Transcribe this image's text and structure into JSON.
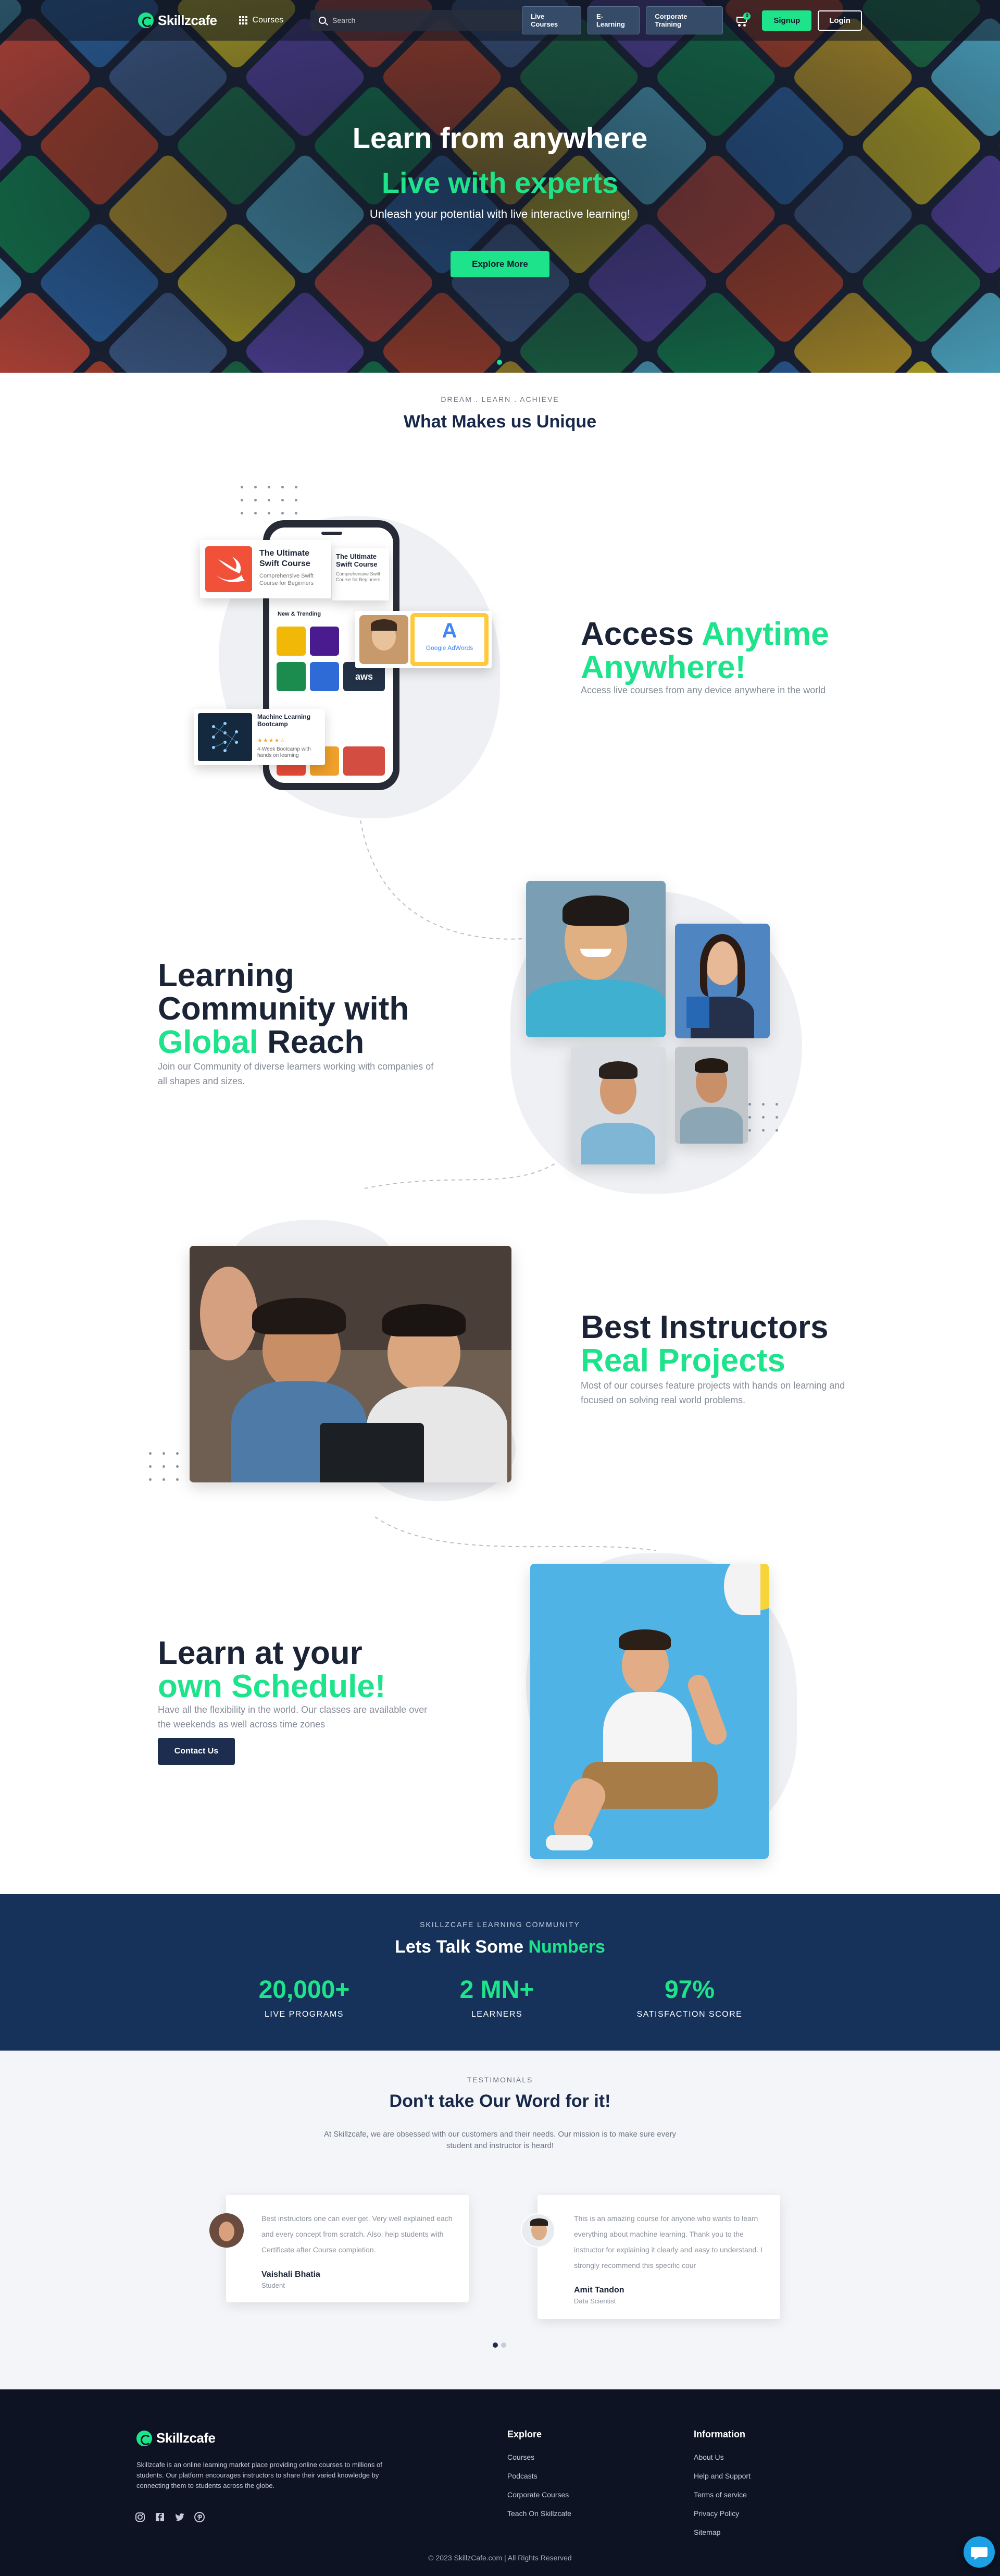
{
  "nav": {
    "logo_text": "Skillzcafe",
    "courses_label": "Courses",
    "search_placeholder": "Search",
    "pills": [
      "Live Courses",
      "E-Learning",
      "Corporate Training"
    ],
    "cart_count": "0",
    "signup_label": "Signup",
    "login_label": "Login"
  },
  "hero": {
    "title": "Learn from anywhere",
    "title_accent": "Live with experts",
    "subtitle": "Unleash your potential with live interactive learning!",
    "cta": "Explore More"
  },
  "unique": {
    "kicker": "DREAM . LEARN . ACHIEVE",
    "title": "What Makes us Unique"
  },
  "features": [
    {
      "heading": "Access ",
      "accent": "Anytime Anywhere!",
      "body": "Access live courses from any device anywhere in the world"
    },
    {
      "heading_line1": "Learning",
      "heading_line2": "Community with",
      "accent": "Global",
      "heading_tail": " Reach",
      "body": "Join our Community of diverse learners working with companies of all shapes and sizes."
    },
    {
      "heading": "Best Instructors",
      "accent": "Real Projects",
      "body": "Most of our courses feature projects with hands on learning and focused on solving real world problems."
    },
    {
      "heading": "Learn at your",
      "accent": "own Schedule!",
      "body": "Have all the flexibility in the world. Our classes are available over the weekends as well across time zones",
      "cta": "Contact Us"
    }
  ],
  "phone_cards": {
    "swift_title": "The Ultimate Swift Course",
    "swift_sub": "Comprehensive Swift Course for Beginners",
    "new_trending": "New & Trending",
    "ml_title": "Machine Learning Bootcamp",
    "ml_sub": "4-Week Bootcamp with hands on learning",
    "google_label": "Google AdWords",
    "aws_label": "aws"
  },
  "stats": {
    "kicker": "SKILLZCAFE LEARNING COMMUNITY",
    "title": "Lets Talk Some ",
    "title_accent": "Numbers",
    "items": [
      {
        "value": "20,000+",
        "label": "LIVE PROGRAMS"
      },
      {
        "value": "2 MN+",
        "label": "LEARNERS"
      },
      {
        "value": "97%",
        "label": "SATISFACTION SCORE"
      }
    ]
  },
  "testimonials": {
    "kicker": "TESTIMONIALS",
    "title": "Don't take Our Word for it!",
    "intro": "At Skillzcafe, we are obsessed with our customers and their needs. Our mission is to make sure every student and instructor is heard!",
    "items": [
      {
        "quote": "Best instructors one can ever get. Very well explained each and every concept from scratch. Also, help students with Certificate after Course completion.",
        "name": "Vaishali Bhatia",
        "role": "Student"
      },
      {
        "quote": "This is an amazing course for anyone who wants to learn everything about machine learning. Thank you to the instructor for explaining it clearly and easy to understand. I strongly recommend this specific cour",
        "name": "Amit Tandon",
        "role": "Data Scientist"
      }
    ]
  },
  "footer": {
    "logo_text": "Skillzcafe",
    "description": "Skillzcafe is an online learning market place providing online courses to millions of students. Our platform encourages instructors to share their varied knowledge by connecting them to students across the globe.",
    "explore_title": "Explore",
    "explore_links": [
      "Courses",
      "Podcasts",
      "Corporate Courses",
      "Teach On Skillzcafe"
    ],
    "info_title": "Information",
    "info_links": [
      "About Us",
      "Help and Support",
      "Terms of service",
      "Privacy Policy",
      "Sitemap"
    ],
    "copyright": "© 2023 SkillzCafe.com | All Rights Reserved"
  },
  "colors": {
    "accent": "#1de38b",
    "navy": "#17325a",
    "footer_bg": "#0d1322"
  }
}
